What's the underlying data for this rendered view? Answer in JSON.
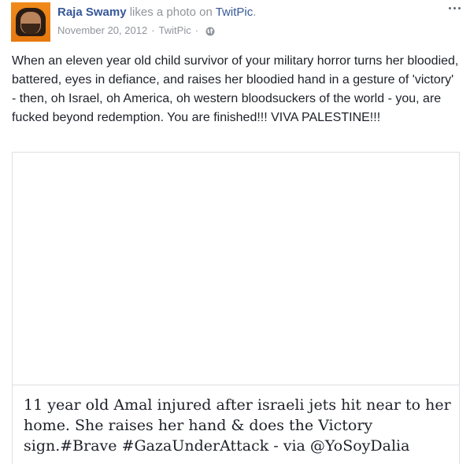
{
  "post": {
    "author": "Raja Swamy",
    "action": " likes a photo on ",
    "source": "TwitPic",
    "source_end": ".",
    "date": "November 20, 2012",
    "separator1": "·",
    "via": "TwitPic",
    "separator2": "·",
    "privacy_icon": "globe-icon",
    "menu_icon": "more-options-icon",
    "text": "When an eleven year old child survivor of your military horror turns her bloodied, battered, eyes in defiance, and raises her bloodied hand in a gesture of 'victory' - then, oh Israel, oh America, oh western bloodsuckers of the world - you, are fucked beyond redemption. You are finished!!! VIVA PALESTINE!!!"
  },
  "attachment": {
    "caption": "11 year old Amal injured after israeli jets hit near to her home. She raises her hand & does the Victory sign.#Brave #GazaUnderAttack - via @YoSoyDalia"
  },
  "colors": {
    "link": "#365899",
    "meta": "#90949c",
    "text": "#1d2129",
    "border": "#dddfe2",
    "avatar_bg": "#f08a1a"
  }
}
